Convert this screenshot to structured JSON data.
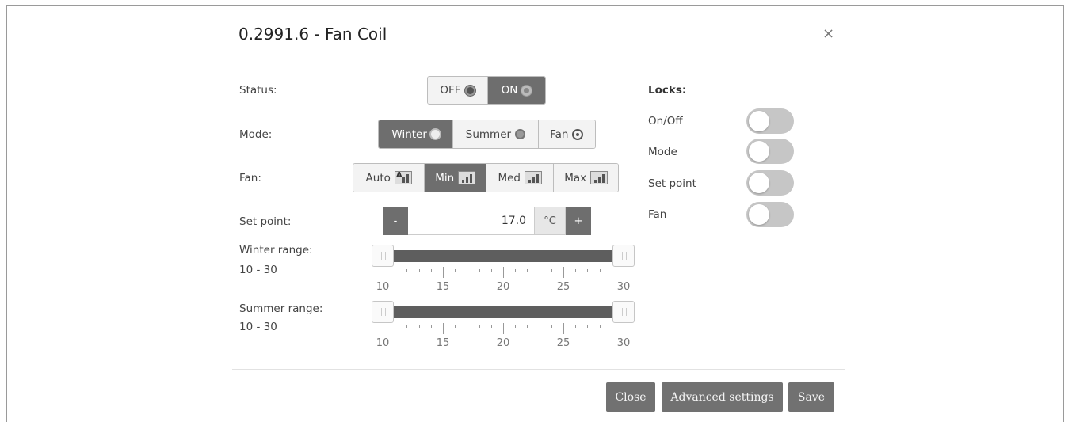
{
  "dialog": {
    "title": "0.2991.6 - Fan Coil",
    "close_glyph": "×"
  },
  "status": {
    "label": "Status:",
    "options": [
      "OFF",
      "ON"
    ],
    "selected": "ON"
  },
  "mode": {
    "label": "Mode:",
    "options": [
      "Winter",
      "Summer",
      "Fan"
    ],
    "selected": "Winter"
  },
  "fan": {
    "label": "Fan:",
    "options": [
      "Auto",
      "Min",
      "Med",
      "Max"
    ],
    "selected": "Min"
  },
  "setpoint": {
    "label": "Set point:",
    "value": "17.0",
    "unit": "°C",
    "minus": "-",
    "plus": "+"
  },
  "winter_range": {
    "label": "Winter range:",
    "value": "10 - 30",
    "min": 10,
    "max": 30,
    "low": 10,
    "high": 30,
    "ticks": [
      "10",
      "15",
      "20",
      "25",
      "30"
    ]
  },
  "summer_range": {
    "label": "Summer range:",
    "value": "10 - 30",
    "min": 10,
    "max": 30,
    "low": 10,
    "high": 30,
    "ticks": [
      "10",
      "15",
      "20",
      "25",
      "30"
    ]
  },
  "locks": {
    "label": "Locks:",
    "items": [
      {
        "label": "On/Off",
        "enabled": false
      },
      {
        "label": "Mode",
        "enabled": false
      },
      {
        "label": "Set point",
        "enabled": false
      },
      {
        "label": "Fan",
        "enabled": false
      }
    ]
  },
  "footer": {
    "close_label": "Close",
    "advanced_label": "Advanced settings",
    "save_label": "Save"
  },
  "colors": {
    "active": "#6e6e6e",
    "button": "#717171",
    "switch_off": "#c6c6c6"
  },
  "icons": {
    "off": "power-off-icon",
    "on": "power-on-icon",
    "winter": "sun-icon",
    "summer": "snowflake-icon",
    "fan": "fan-icon",
    "bars": "fan-speed-bars-icon"
  }
}
